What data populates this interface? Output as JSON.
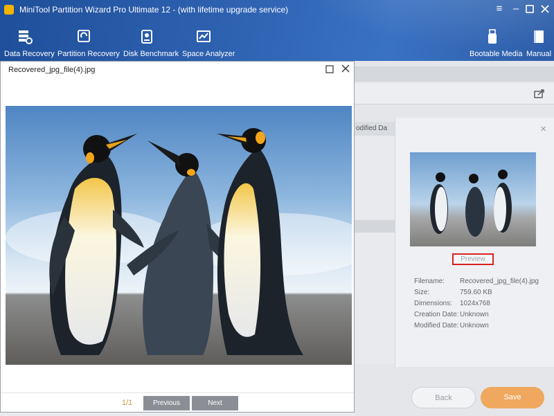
{
  "window": {
    "title": "MiniTool Partition Wizard Pro Ultimate 12 - (with lifetime upgrade service)"
  },
  "toolbar": {
    "items": [
      {
        "label": "Data Recovery",
        "icon": "data-recovery-icon"
      },
      {
        "label": "Partition Recovery",
        "icon": "partition-recovery-icon"
      },
      {
        "label": "Disk Benchmark",
        "icon": "disk-benchmark-icon"
      },
      {
        "label": "Space Analyzer",
        "icon": "space-analyzer-icon"
      }
    ],
    "right_items": [
      {
        "label": "Bootable Media",
        "icon": "usb-icon"
      },
      {
        "label": "Manual",
        "icon": "book-icon"
      }
    ]
  },
  "preview_window": {
    "title": "Recovered_jpg_file(4).jpg",
    "page_indicator": "1/1",
    "previous_label": "Previous",
    "next_label": "Next"
  },
  "background": {
    "column_header": "odified Da",
    "preview_button": "Preview",
    "details": [
      {
        "label": "Filename:",
        "value": "Recovered_jpg_file(4).jpg"
      },
      {
        "label": "Size:",
        "value": "759.60 KB"
      },
      {
        "label": "Dimensions:",
        "value": "1024x768"
      },
      {
        "label": "Creation Date:",
        "value": "Unknown"
      },
      {
        "label": "Modified Date:",
        "value": "Unknown"
      }
    ],
    "back_label": "Back",
    "save_label": "Save"
  },
  "colors": {
    "ribbon": "#2f64b3",
    "save": "#f0a85e",
    "highlight": "#d92020"
  }
}
